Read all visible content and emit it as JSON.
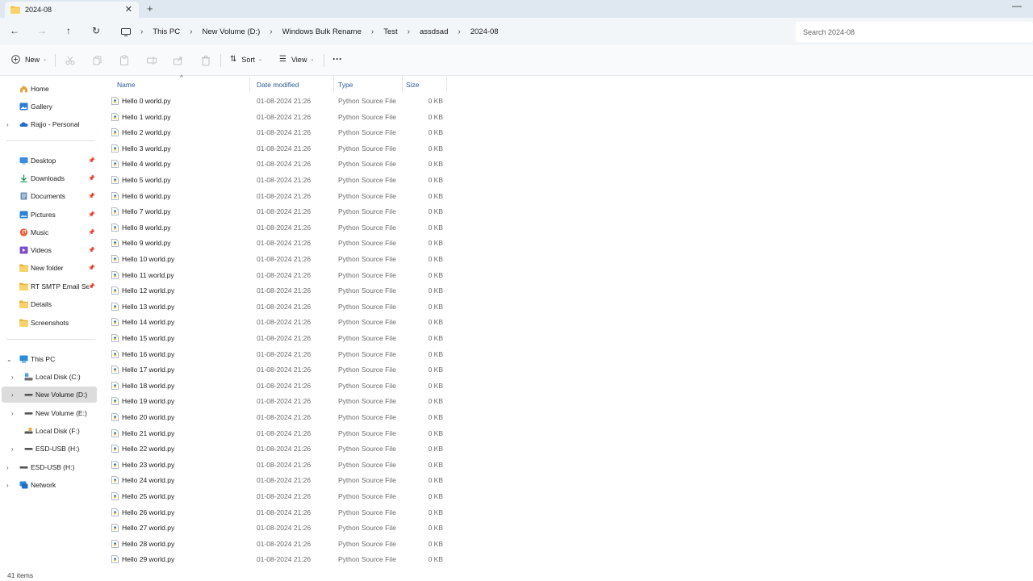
{
  "tab": {
    "title": "2024-08",
    "close": "✕",
    "new": "+"
  },
  "window": {
    "minimize": "—"
  },
  "nav_buttons": {
    "back": "←",
    "forward": "→",
    "up": "↑",
    "refresh": "↻"
  },
  "breadcrumb": [
    "This PC",
    "New Volume (D:)",
    "Windows Bulk Rename",
    "Test",
    "assdsad",
    "2024-08"
  ],
  "breadcrumb_chevron": "›",
  "search": {
    "placeholder": "Search 2024-08"
  },
  "commands": {
    "new_label": "New",
    "sort_label": "Sort",
    "view_label": "View",
    "more": "···",
    "caret": "⌄"
  },
  "sidebar": {
    "quick": [
      {
        "label": "Home",
        "icon": "home-icon"
      },
      {
        "label": "Gallery",
        "icon": "gallery-icon"
      },
      {
        "label": "Rajjo - Personal",
        "icon": "onedrive-cloud-icon",
        "expander": "›"
      }
    ],
    "pinned": [
      {
        "label": "Desktop",
        "icon": "desktop-icon"
      },
      {
        "label": "Downloads",
        "icon": "downloads-icon"
      },
      {
        "label": "Documents",
        "icon": "documents-icon"
      },
      {
        "label": "Pictures",
        "icon": "pictures-icon"
      },
      {
        "label": "Music",
        "icon": "music-icon"
      },
      {
        "label": "Videos",
        "icon": "videos-icon"
      },
      {
        "label": "New folder",
        "icon": "folder-icon"
      },
      {
        "label": "RT SMTP Email Sender",
        "icon": "folder-icon"
      }
    ],
    "recent": [
      {
        "label": "Details",
        "icon": "folder-icon"
      },
      {
        "label": "Screenshots",
        "icon": "folder-icon"
      }
    ],
    "this_pc": {
      "label": "This PC",
      "expander": "⌄"
    },
    "drives": [
      {
        "label": "Local Disk (C:)",
        "icon": "windows-drive-icon",
        "expander": "›"
      },
      {
        "label": "New Volume (D:)",
        "icon": "drive-icon",
        "expander": "›",
        "selected": true
      },
      {
        "label": "New Volume (E:)",
        "icon": "drive-icon",
        "expander": "›"
      },
      {
        "label": "Local Disk (F:)",
        "icon": "locked-drive-icon",
        "expander": ""
      },
      {
        "label": "ESD-USB (H:)",
        "icon": "drive-icon",
        "expander": "›"
      }
    ],
    "bottom": [
      {
        "label": "ESD-USB (H:)",
        "icon": "drive-icon",
        "expander": "›"
      },
      {
        "label": "Network",
        "icon": "network-icon",
        "expander": "›"
      }
    ],
    "pin_glyph": "📌"
  },
  "columns": {
    "name": "Name",
    "date": "Date modified",
    "type": "Type",
    "size": "Size",
    "sort_indicator": "^"
  },
  "files": [
    {
      "name": "Hello 0 world.py",
      "date": "01-08-2024 21:26",
      "type": "Python Source File",
      "size": "0 KB"
    },
    {
      "name": "Hello 1 world.py",
      "date": "01-08-2024 21:26",
      "type": "Python Source File",
      "size": "0 KB"
    },
    {
      "name": "Hello 2 world.py",
      "date": "01-08-2024 21:26",
      "type": "Python Source File",
      "size": "0 KB"
    },
    {
      "name": "Hello 3 world.py",
      "date": "01-08-2024 21:26",
      "type": "Python Source File",
      "size": "0 KB"
    },
    {
      "name": "Hello 4 world.py",
      "date": "01-08-2024 21:26",
      "type": "Python Source File",
      "size": "0 KB"
    },
    {
      "name": "Hello 5 world.py",
      "date": "01-08-2024 21:26",
      "type": "Python Source File",
      "size": "0 KB"
    },
    {
      "name": "Hello 6 world.py",
      "date": "01-08-2024 21:26",
      "type": "Python Source File",
      "size": "0 KB"
    },
    {
      "name": "Hello 7 world.py",
      "date": "01-08-2024 21:26",
      "type": "Python Source File",
      "size": "0 KB"
    },
    {
      "name": "Hello 8 world.py",
      "date": "01-08-2024 21:26",
      "type": "Python Source File",
      "size": "0 KB"
    },
    {
      "name": "Hello 9 world.py",
      "date": "01-08-2024 21:26",
      "type": "Python Source File",
      "size": "0 KB"
    },
    {
      "name": "Hello 10 world.py",
      "date": "01-08-2024 21:26",
      "type": "Python Source File",
      "size": "0 KB"
    },
    {
      "name": "Hello 11 world.py",
      "date": "01-08-2024 21:26",
      "type": "Python Source File",
      "size": "0 KB"
    },
    {
      "name": "Hello 12 world.py",
      "date": "01-08-2024 21:26",
      "type": "Python Source File",
      "size": "0 KB"
    },
    {
      "name": "Hello 13 world.py",
      "date": "01-08-2024 21:26",
      "type": "Python Source File",
      "size": "0 KB"
    },
    {
      "name": "Hello 14 world.py",
      "date": "01-08-2024 21:26",
      "type": "Python Source File",
      "size": "0 KB"
    },
    {
      "name": "Hello 15 world.py",
      "date": "01-08-2024 21:26",
      "type": "Python Source File",
      "size": "0 KB"
    },
    {
      "name": "Hello 16 world.py",
      "date": "01-08-2024 21:26",
      "type": "Python Source File",
      "size": "0 KB"
    },
    {
      "name": "Hello 17 world.py",
      "date": "01-08-2024 21:26",
      "type": "Python Source File",
      "size": "0 KB"
    },
    {
      "name": "Hello 18 world.py",
      "date": "01-08-2024 21:26",
      "type": "Python Source File",
      "size": "0 KB"
    },
    {
      "name": "Hello 19 world.py",
      "date": "01-08-2024 21:26",
      "type": "Python Source File",
      "size": "0 KB"
    },
    {
      "name": "Hello 20 world.py",
      "date": "01-08-2024 21:26",
      "type": "Python Source File",
      "size": "0 KB"
    },
    {
      "name": "Hello 21 world.py",
      "date": "01-08-2024 21:26",
      "type": "Python Source File",
      "size": "0 KB"
    },
    {
      "name": "Hello 22 world.py",
      "date": "01-08-2024 21:26",
      "type": "Python Source File",
      "size": "0 KB"
    },
    {
      "name": "Hello 23 world.py",
      "date": "01-08-2024 21:26",
      "type": "Python Source File",
      "size": "0 KB"
    },
    {
      "name": "Hello 24 world.py",
      "date": "01-08-2024 21:26",
      "type": "Python Source File",
      "size": "0 KB"
    },
    {
      "name": "Hello 25 world.py",
      "date": "01-08-2024 21:26",
      "type": "Python Source File",
      "size": "0 KB"
    },
    {
      "name": "Hello 26 world.py",
      "date": "01-08-2024 21:26",
      "type": "Python Source File",
      "size": "0 KB"
    },
    {
      "name": "Hello 27 world.py",
      "date": "01-08-2024 21:26",
      "type": "Python Source File",
      "size": "0 KB"
    },
    {
      "name": "Hello 28 world.py",
      "date": "01-08-2024 21:26",
      "type": "Python Source File",
      "size": "0 KB"
    },
    {
      "name": "Hello 29 world.py",
      "date": "01-08-2024 21:26",
      "type": "Python Source File",
      "size": "0 KB"
    }
  ],
  "status": {
    "count": "41 items"
  },
  "colors": {
    "title_bg": "#dfe8f1",
    "accent_blue": "#2a5a97",
    "folder_yellow": "#f4c04e",
    "selected_bg": "#dcdcdc"
  }
}
